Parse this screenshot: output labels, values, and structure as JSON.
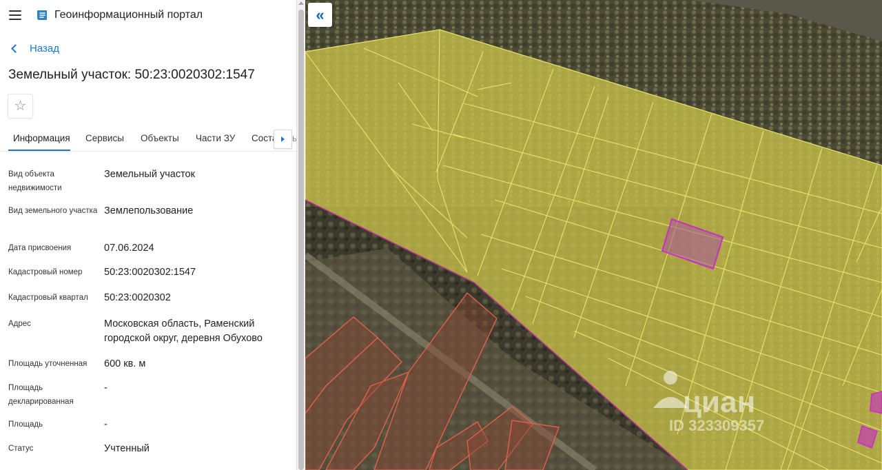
{
  "header": {
    "app_title": "Геоинформационный портал",
    "menu_icon": "hamburger-menu-icon",
    "logo_icon": "portal-logo-icon"
  },
  "back": {
    "label": "Назад"
  },
  "page": {
    "title": "Земельный участок: 50:23:0020302:1547"
  },
  "favorite": {
    "icon": "☆"
  },
  "tabs": [
    {
      "label": "Информация",
      "active": true
    },
    {
      "label": "Сервисы",
      "active": false
    },
    {
      "label": "Объекты",
      "active": false
    },
    {
      "label": "Части ЗУ",
      "active": false
    },
    {
      "label": "Соста",
      "active": false
    }
  ],
  "tab_overflow": "ы",
  "info": [
    {
      "label": "Вид объекта недвижимости",
      "value": "Земельный участок"
    },
    {
      "label": "Вид земельного участка",
      "value": "Землепользование"
    },
    {
      "label": "Дата присвоения",
      "value": "07.06.2024"
    },
    {
      "label": "Кадастровый номер",
      "value": "50:23:0020302:1547"
    },
    {
      "label": "Кадастровый квартал",
      "value": "50:23:0020302"
    },
    {
      "label": "Адрес",
      "value": "Московская область, Раменский городской округ, деревня Обухово"
    },
    {
      "label": "Площадь уточненная",
      "value": "600 кв. м"
    },
    {
      "label": "Площадь декларированная",
      "value": "-"
    },
    {
      "label": "Площадь",
      "value": "-"
    },
    {
      "label": "Статус",
      "value": "Учтенный"
    }
  ],
  "map": {
    "collapse_icon": "«",
    "watermark_brand": "циан",
    "watermark_id": "ID 323309357",
    "colors": {
      "parcel_fill": "#c9c24a",
      "parcel_line": "#ece26a",
      "selected_parcel": "#b23bb5",
      "boundary_line": "#c0289f",
      "neighbor_parcel_line": "#e2614a"
    }
  }
}
